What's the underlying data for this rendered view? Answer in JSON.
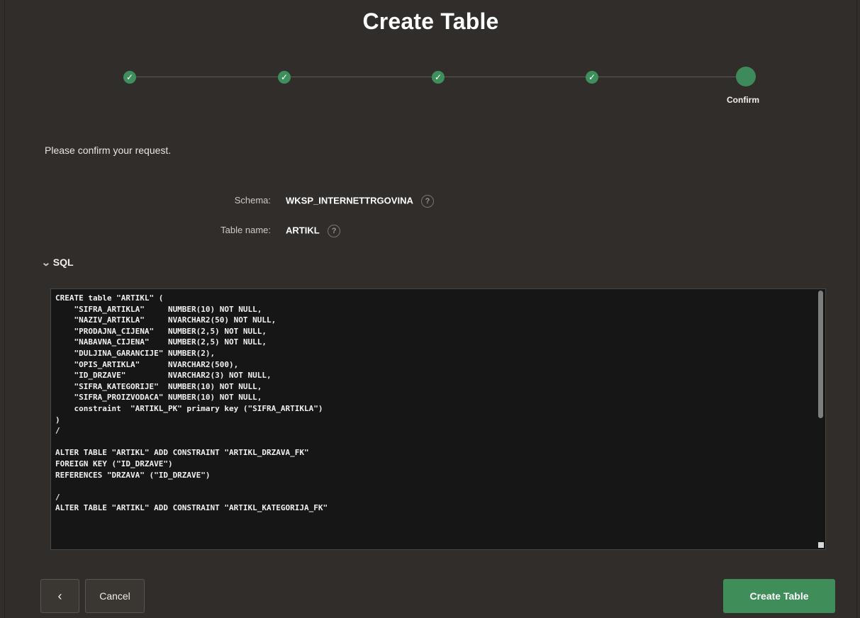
{
  "dialog": {
    "title": "Create Table"
  },
  "wizard": {
    "steps": [
      {
        "state": "complete",
        "icon": "check-icon"
      },
      {
        "state": "complete",
        "icon": "check-icon"
      },
      {
        "state": "complete",
        "icon": "check-icon"
      },
      {
        "state": "complete",
        "icon": "check-icon"
      },
      {
        "state": "current",
        "label": "Confirm"
      }
    ]
  },
  "confirmation": {
    "text": "Please confirm your request."
  },
  "fields": {
    "schema_label": "Schema:",
    "schema_value": "WKSP_INTERNETTRGOVINA",
    "table_name_label": "Table name:",
    "table_name_value": "ARTIKL"
  },
  "sql_section": {
    "title": "SQL",
    "code": "CREATE table \"ARTIKL\" (\n    \"SIFRA_ARTIKLA\"     NUMBER(10) NOT NULL,\n    \"NAZIV_ARTIKLA\"     NVARCHAR2(50) NOT NULL,\n    \"PRODAJNA_CIJENA\"   NUMBER(2,5) NOT NULL,\n    \"NABAVNA_CIJENA\"    NUMBER(2,5) NOT NULL,\n    \"DULJINA_GARANCIJE\" NUMBER(2),\n    \"OPIS_ARTIKLA\"      NVARCHAR2(500),\n    \"ID_DRZAVE\"         NVARCHAR2(3) NOT NULL,\n    \"SIFRA_KATEGORIJE\"  NUMBER(10) NOT NULL,\n    \"SIFRA_PROIZVODACA\" NUMBER(10) NOT NULL,\n    constraint  \"ARTIKL_PK\" primary key (\"SIFRA_ARTIKLA\")\n)\n/\n\nALTER TABLE \"ARTIKL\" ADD CONSTRAINT \"ARTIKL_DRZAVA_FK\"\nFOREIGN KEY (\"ID_DRZAVE\")\nREFERENCES \"DRZAVA\" (\"ID_DRZAVE\")\n\n/\nALTER TABLE \"ARTIKL\" ADD CONSTRAINT \"ARTIKL_KATEGORIJA_FK\""
  },
  "buttons": {
    "back_icon": "chevron-left-icon",
    "back_glyph": "‹",
    "cancel_label": "Cancel",
    "create_label": "Create Table"
  },
  "colors": {
    "background": "#312d2a",
    "accent_green": "#3f8d58",
    "code_background": "#161616"
  }
}
